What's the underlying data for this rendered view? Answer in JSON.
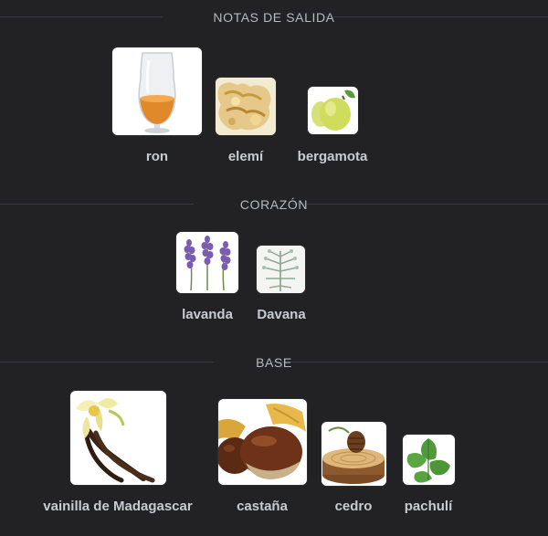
{
  "sections": {
    "top": {
      "title": "NOTAS DE SALIDA"
    },
    "heart": {
      "title": "CORAZÓN"
    },
    "base": {
      "title": "BASE"
    }
  },
  "notes": {
    "ron": {
      "label": "ron",
      "icon": "rum-glass-icon"
    },
    "elemi": {
      "label": "elemí",
      "icon": "elemi-resin-icon"
    },
    "bergamota": {
      "label": "bergamota",
      "icon": "bergamot-fruit-icon"
    },
    "lavanda": {
      "label": "lavanda",
      "icon": "lavender-flower-icon"
    },
    "davana": {
      "label": "Davana",
      "icon": "davana-herb-icon"
    },
    "vainilla": {
      "label": "vainilla de Madagascar",
      "icon": "vanilla-orchid-icon"
    },
    "castana": {
      "label": "castaña",
      "icon": "chestnut-icon"
    },
    "cedro": {
      "label": "cedro",
      "icon": "cedar-wood-icon"
    },
    "pachuli": {
      "label": "pachulí",
      "icon": "patchouli-leaf-icon"
    }
  },
  "colors": {
    "background": "#222224",
    "section_title": "#b7b9c4",
    "divider": "#3a3a3e",
    "label": "#c9cbd2"
  }
}
